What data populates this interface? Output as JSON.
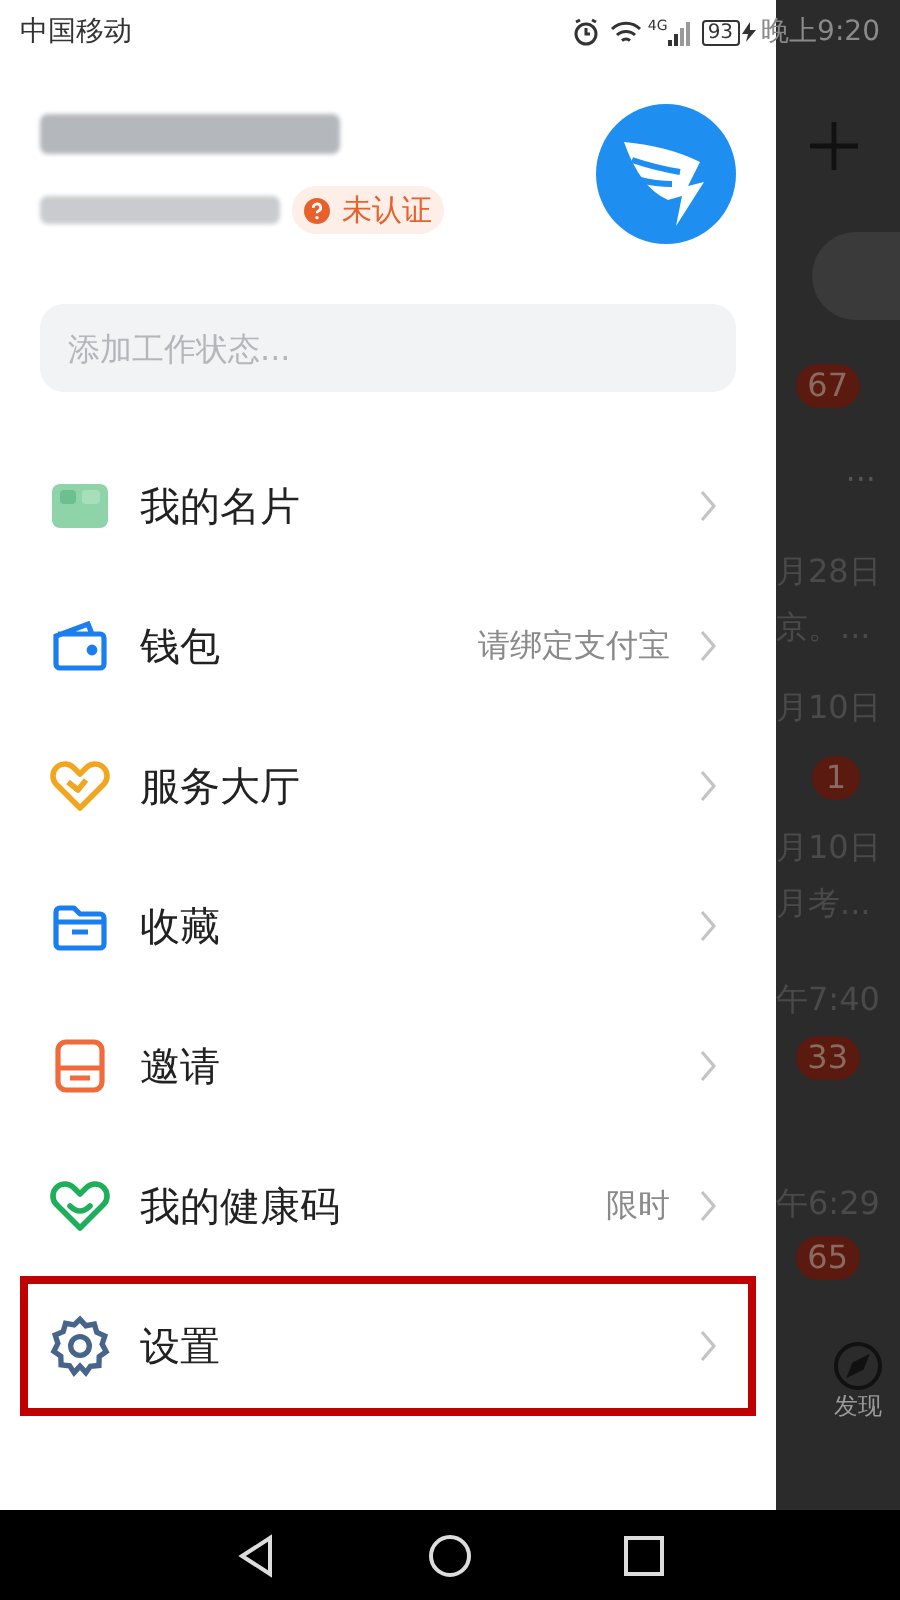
{
  "status_bar": {
    "carrier": "中国移动",
    "network": "4G",
    "battery": "93",
    "time": "晚上9:20"
  },
  "profile": {
    "badge": "未认证",
    "status_field": {
      "placeholder": "添加工作状态..."
    }
  },
  "menu": [
    {
      "label": "我的名片",
      "highlighted": false
    },
    {
      "label": "钱包",
      "hint": "请绑定支付宝",
      "highlighted": false
    },
    {
      "label": "服务大厅",
      "highlighted": false
    },
    {
      "label": "收藏",
      "highlighted": false
    },
    {
      "label": "邀请",
      "highlighted": false
    },
    {
      "label": "我的健康码",
      "hint": "限时",
      "highlighted": false
    },
    {
      "label": "设置",
      "highlighted": true
    }
  ],
  "background_screen": {
    "items": [
      {
        "kind": "plus"
      },
      {
        "kind": "bubble"
      },
      {
        "kind": "badge",
        "text": "67"
      },
      {
        "kind": "dots",
        "text": "···"
      },
      {
        "kind": "text",
        "text": "月28日"
      },
      {
        "kind": "text",
        "text": "京。..."
      },
      {
        "kind": "text",
        "text": "月10日"
      },
      {
        "kind": "badge",
        "text": "1"
      },
      {
        "kind": "text",
        "text": "月10日"
      },
      {
        "kind": "text",
        "text": "月考..."
      },
      {
        "kind": "text",
        "text": "午7:40"
      },
      {
        "kind": "badge",
        "text": "33"
      },
      {
        "kind": "text",
        "text": "午6:29"
      },
      {
        "kind": "badge",
        "text": "65"
      },
      {
        "kind": "tab",
        "text": "发现"
      }
    ]
  }
}
